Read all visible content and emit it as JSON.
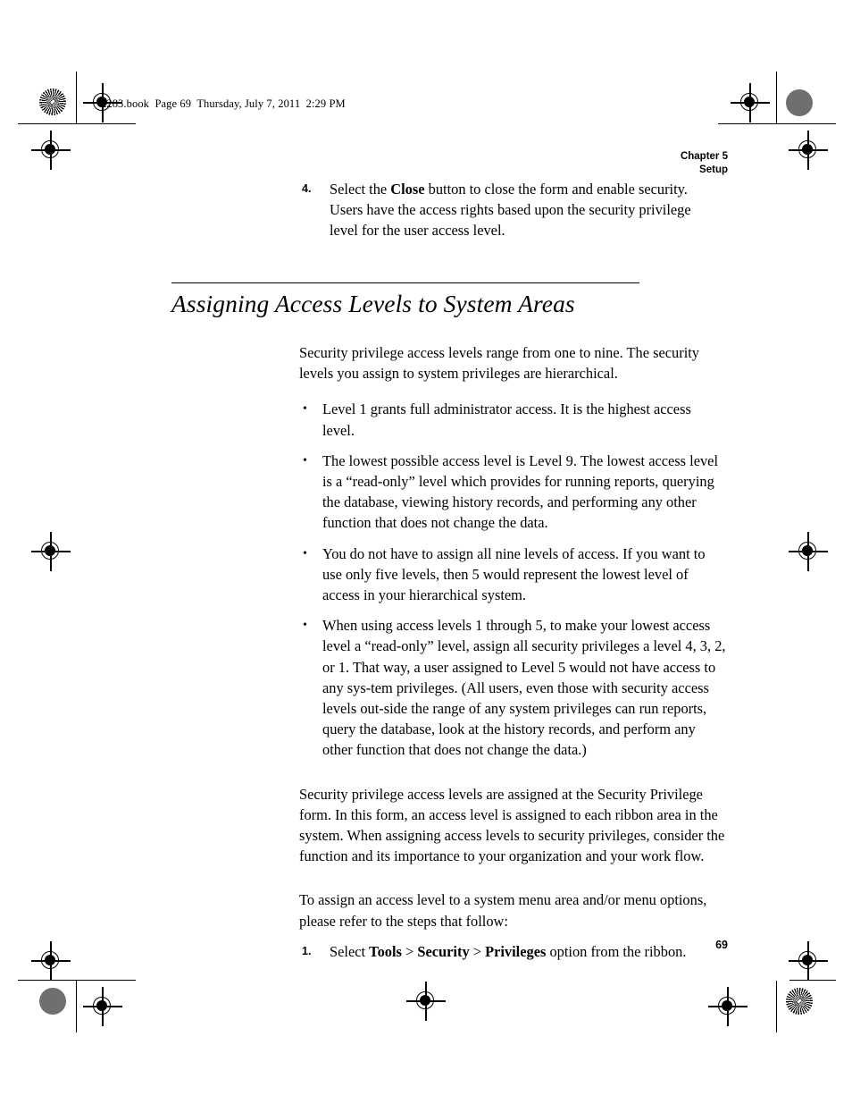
{
  "page": {
    "file_info": "2283.book  Page 69  Thursday, July 7, 2011  2:29 PM",
    "page_number": "69"
  },
  "chapter_header": {
    "chapter": "Chapter 5",
    "section": "Setup"
  },
  "step_four": {
    "number": "4.",
    "text_before": "Select the ",
    "bold_term": "Close",
    "text_after": " button to close the form and enable security. Users have the access rights based upon the security privilege level for the user access level."
  },
  "section": {
    "heading": "Assigning Access Levels to System Areas",
    "intro_paragraph": "Security privilege access levels range from one to nine. The security levels you assign to system privileges are hierarchical.",
    "bullets": [
      "Level 1 grants full administrator access. It is the highest access level.",
      "The lowest possible access level is Level 9. The lowest access level is a “read-only” level which provides for running reports, querying the database, viewing history records, and performing any other function that does not change the data.",
      "You do not have to assign all nine levels of access. If you want to use only five levels, then 5 would represent the lowest level of access in your hierarchical system.",
      "When using access levels 1 through 5, to make your lowest access level a “read-only” level, assign all security privileges a level 4, 3, 2, or 1. That way, a user assigned to Level 5 would not have access to any sys-tem privileges. (All users, even those with security access levels out-side the range of any system privileges can run reports, query the database, look at the history records, and perform any other function that does not change the data.)"
    ],
    "paragraph_two": "Security privilege access levels are assigned at the Security Privilege form. In this form, an access level is assigned to each ribbon area in the system. When assigning access levels to security privileges, consider the function and its importance to your organization and your work flow.",
    "paragraph_three": "To assign an access level to a system menu area and/or menu options, please refer to the steps that follow:"
  },
  "step_one": {
    "number": "1.",
    "text_before": "Select ",
    "menu_one": "Tools",
    "separator_one": " > ",
    "menu_two": "Security",
    "separator_two": " > ",
    "menu_three": "Privileges",
    "text_after": " option from the ribbon."
  }
}
